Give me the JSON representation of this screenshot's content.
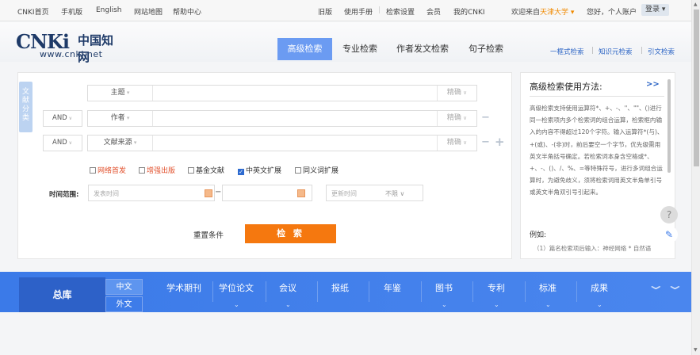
{
  "topbar": {
    "home": "CNKI首页",
    "mobile": "手机版",
    "english": "English",
    "sitemap": "网站地图",
    "help": "帮助中心",
    "old": "旧版",
    "manual": "使用手册",
    "search_settings": "检索设置",
    "member": "会员",
    "mycnki": "我的CNKI",
    "welcome": "欢迎来自",
    "institution": "天津大学 ▾",
    "greeting": "您好，个人账户",
    "login": "登录 ▾"
  },
  "logo": {
    "mark": "CNKi",
    "cn": "中国知网",
    "url": "www.cnki.net"
  },
  "tabs": [
    "高级检索",
    "专业检索",
    "作者发文检索",
    "句子检索"
  ],
  "right_links": [
    "一框式检索",
    "知识元检索",
    "引文检索"
  ],
  "side_tab": "文献分类",
  "rows": [
    {
      "logic": "",
      "field": "主题",
      "exact": "精确"
    },
    {
      "logic": "AND",
      "field": "作者",
      "exact": "精确"
    },
    {
      "logic": "AND",
      "field": "文献来源",
      "exact": "精确"
    }
  ],
  "controls": {
    "minus": "−",
    "plus": "+"
  },
  "checkboxes": [
    {
      "label": "网络首发",
      "checked": false,
      "color": "#e2512d"
    },
    {
      "label": "增强出版",
      "checked": false,
      "color": "#e2512d"
    },
    {
      "label": "基金文献",
      "checked": false,
      "color": "#333333"
    },
    {
      "label": "中英文扩展",
      "checked": true,
      "color": "#333333"
    },
    {
      "label": "同义词扩展",
      "checked": false,
      "color": "#333333"
    }
  ],
  "time": {
    "label": "时间范围:",
    "publish": "发表时间",
    "dash": "−",
    "update": "更新时间",
    "update_value": "不限 ∨"
  },
  "actions": {
    "reset": "重置条件",
    "search": "检 索"
  },
  "help": {
    "title": "高级检索使用方法:",
    "more": ">>",
    "text": "高级检索支持使用运算符*、+、-、''、\"\"、()进行同一检索项内多个检索词的组合运算，检索框内输入的内容不得超过120个字符。输入运算符*(与)、+(或)、-(非)时，前后要空一个字节，优先级需用英文半角括号确定。若检索词本身含空格或*、+、-、()、/、%、=等特殊符号，进行多词组合运算时，为避免歧义，须将检索词用英文半角单引号或英文半角双引号引起来。",
    "example": "例如:",
    "example_line": "（1）篇名检索项后输入：神经网络 * 自然语"
  },
  "fabs": [
    "?",
    "✎"
  ],
  "bottom": {
    "zongku": "总库",
    "lang_cn": "中文",
    "lang_en": "外文",
    "cats": [
      "学术期刊",
      "学位论文",
      "会议",
      "报纸",
      "年鉴",
      "图书",
      "专利",
      "标准",
      "成果"
    ],
    "expand": "⌄⌄"
  }
}
